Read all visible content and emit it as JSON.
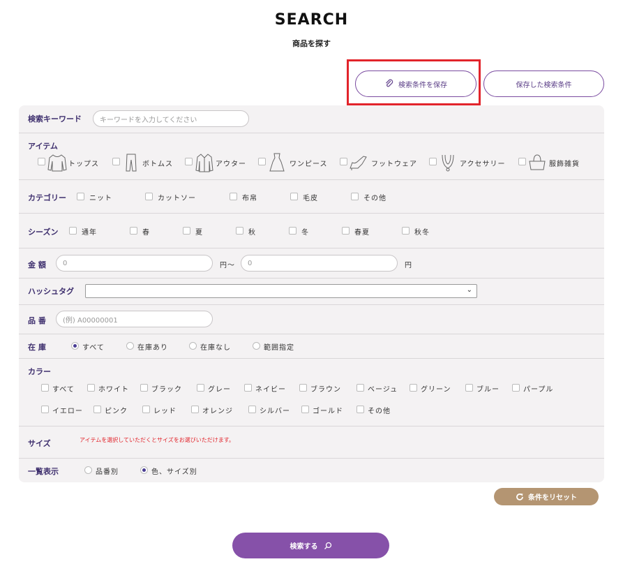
{
  "header": {
    "title": "SEARCH",
    "subtitle": "商品を探す"
  },
  "top_buttons": {
    "save_label": "検索条件を保存",
    "saved_label": "保存した検索条件"
  },
  "keyword": {
    "label": "検索キーワード",
    "placeholder": "キーワードを入力してください"
  },
  "item": {
    "label": "アイテム",
    "options": [
      "トップス",
      "ボトムス",
      "アウター",
      "ワンピース",
      "フットウェア",
      "アクセサリー",
      "服飾雑貨"
    ]
  },
  "category": {
    "label": "カテゴリー",
    "options": [
      "ニット",
      "カットソー",
      "布帛",
      "毛皮",
      "その他"
    ]
  },
  "season": {
    "label": "シーズン",
    "options": [
      "通年",
      "春",
      "夏",
      "秋",
      "冬",
      "春夏",
      "秋冬"
    ]
  },
  "price": {
    "label": "金 額",
    "min_placeholder": "0",
    "max_placeholder": "0",
    "unit_mid": "円～",
    "unit_end": "円"
  },
  "hashtag": {
    "label": "ハッシュタグ",
    "value": ""
  },
  "product_no": {
    "label": "品 番",
    "placeholder": "(例) A00000001"
  },
  "stock": {
    "label": "在 庫",
    "options": [
      "すべて",
      "在庫あり",
      "在庫なし",
      "範囲指定"
    ],
    "selected": "すべて"
  },
  "color": {
    "label": "カラー",
    "row1": [
      "すべて",
      "ホワイト",
      "ブラック",
      "グレー",
      "ネイビー",
      "ブラウン",
      "ベージュ",
      "グリーン",
      "ブルー",
      "パープル"
    ],
    "row2": [
      "イエロー",
      "ピンク",
      "レッド",
      "オレンジ",
      "シルバー",
      "ゴールド",
      "その他"
    ]
  },
  "size": {
    "label": "サイズ",
    "note": "アイテムを選択していただくとサイズをお選びいただけます。"
  },
  "display": {
    "label": "一覧表示",
    "options": [
      "品番別",
      "色、サイズ別"
    ],
    "selected": "色、サイズ別"
  },
  "actions": {
    "reset_label": "条件をリセット",
    "search_label": "検索する"
  },
  "colors": {
    "accent": "#8651a9",
    "reset": "#b49572",
    "label_text": "#3e2f6e",
    "highlight": "#e2242b"
  },
  "icons": [
    "paperclip-icon",
    "tops-icon",
    "bottoms-icon",
    "outer-icon",
    "onepiece-icon",
    "footwear-icon",
    "accessory-icon",
    "goods-icon",
    "refresh-icon",
    "search-icon"
  ]
}
